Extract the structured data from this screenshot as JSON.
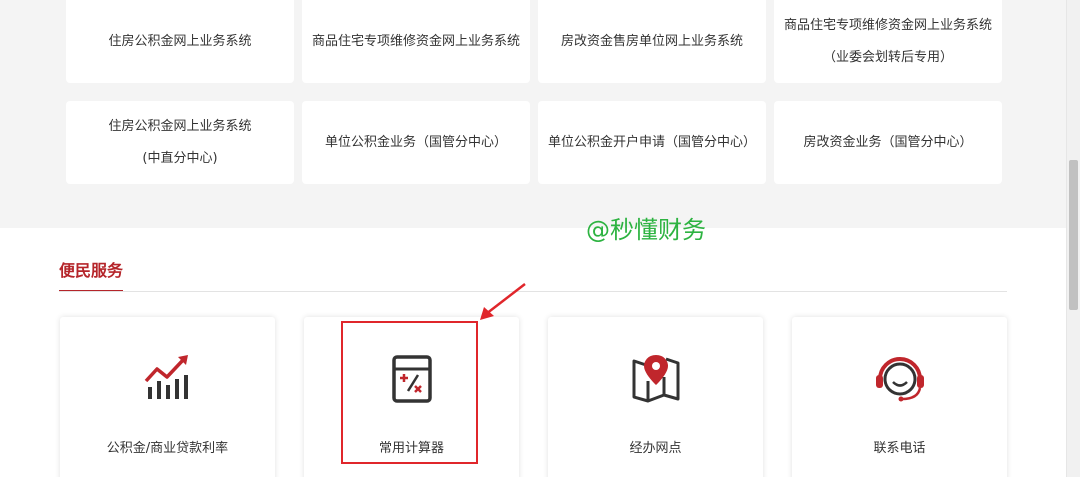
{
  "business_systems": [
    {
      "line1": "住房公积金网上业务系统",
      "line2": ""
    },
    {
      "line1": "商品住宅专项维修资金网上业务系统",
      "line2": ""
    },
    {
      "line1": "房改资金售房单位网上业务系统",
      "line2": ""
    },
    {
      "line1": "商品住宅专项维修资金网上业务系统",
      "line2": "（业委会划转后专用）"
    },
    {
      "line1": "住房公积金网上业务系统",
      "line2": "(中直分中心)"
    },
    {
      "line1": "单位公积金业务（国管分中心）",
      "line2": ""
    },
    {
      "line1": "单位公积金开户申请（国管分中心）",
      "line2": ""
    },
    {
      "line1": "房改资金业务（国管分中心）",
      "line2": ""
    }
  ],
  "watermark": "@秒懂财务",
  "section": {
    "title": "便民服务"
  },
  "services": [
    {
      "label": "公积金/商业贷款利率",
      "icon": "bar-chart-trend-icon"
    },
    {
      "label": "常用计算器",
      "icon": "calculator-icon"
    },
    {
      "label": "经办网点",
      "icon": "map-location-icon"
    },
    {
      "label": "联系电话",
      "icon": "headset-icon"
    }
  ],
  "colors": {
    "accent": "#b5252a",
    "highlight": "#e0262b",
    "watermark": "#2db341"
  }
}
